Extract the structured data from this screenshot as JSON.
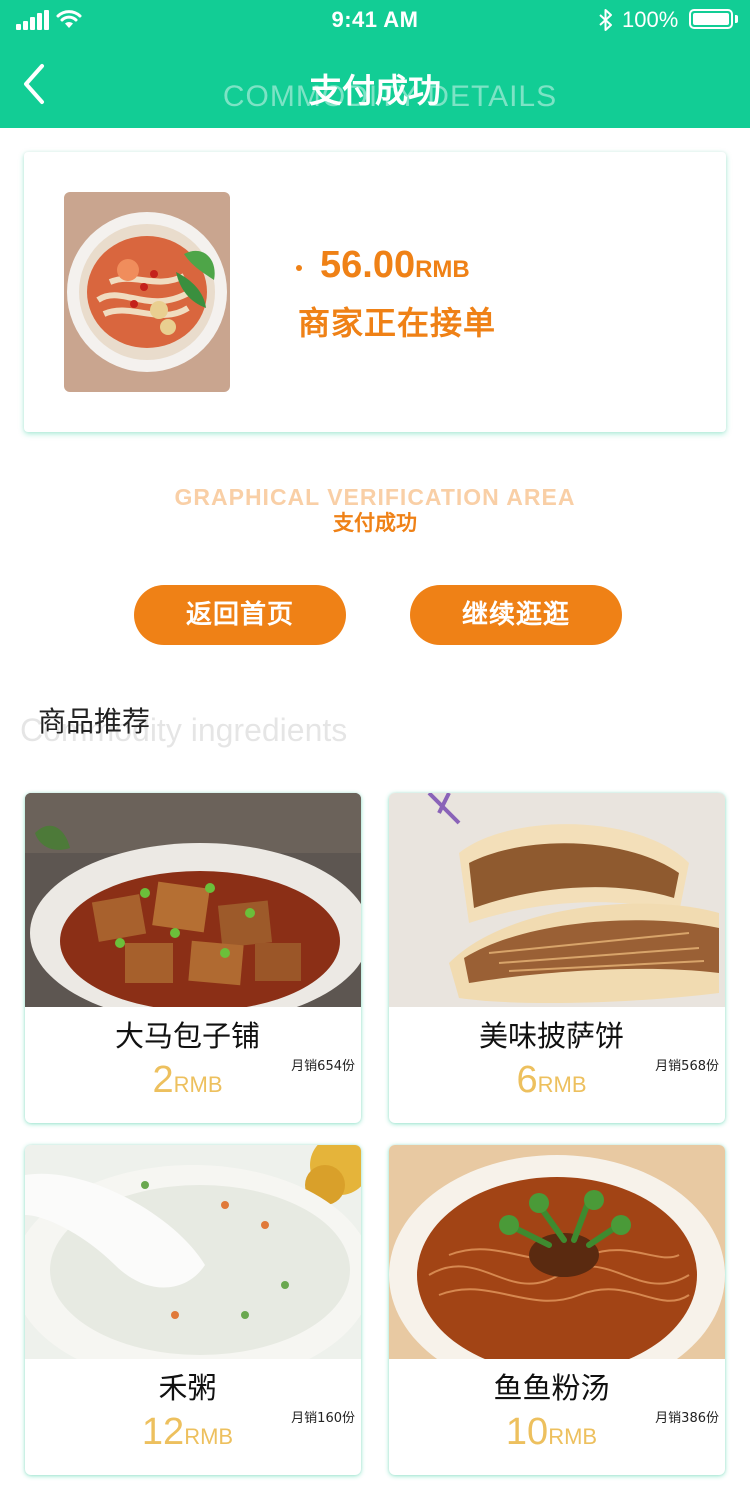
{
  "status_bar": {
    "time": "9:41 AM",
    "battery": "100%"
  },
  "header": {
    "title": "支付成功",
    "ghost_title": "COMMODITY DETAILS"
  },
  "order": {
    "amount": "56.00",
    "unit": "RMB",
    "status": "商家正在接单"
  },
  "verification": {
    "ghost": "GRAPHICAL VERIFICATION AREA",
    "text": "支付成功"
  },
  "buttons": {
    "home": "返回首页",
    "continue": "继续逛逛"
  },
  "recommend": {
    "title": "商品推荐",
    "ghost": "Commodity ingredients",
    "items": [
      {
        "name": "大马包子铺",
        "price": "2",
        "unit": "RMB",
        "sales": "月销654份"
      },
      {
        "name": "美味披萨饼",
        "price": "6",
        "unit": "RMB",
        "sales": "月销568份"
      },
      {
        "name": "禾粥",
        "price": "12",
        "unit": "RMB",
        "sales": "月销160份"
      },
      {
        "name": "鱼鱼粉汤",
        "price": "10",
        "unit": "RMB",
        "sales": "月销386份"
      }
    ]
  },
  "colors": {
    "brand_green": "#12cd95",
    "accent_orange": "#ef8116",
    "price_gold": "#edc05e"
  }
}
